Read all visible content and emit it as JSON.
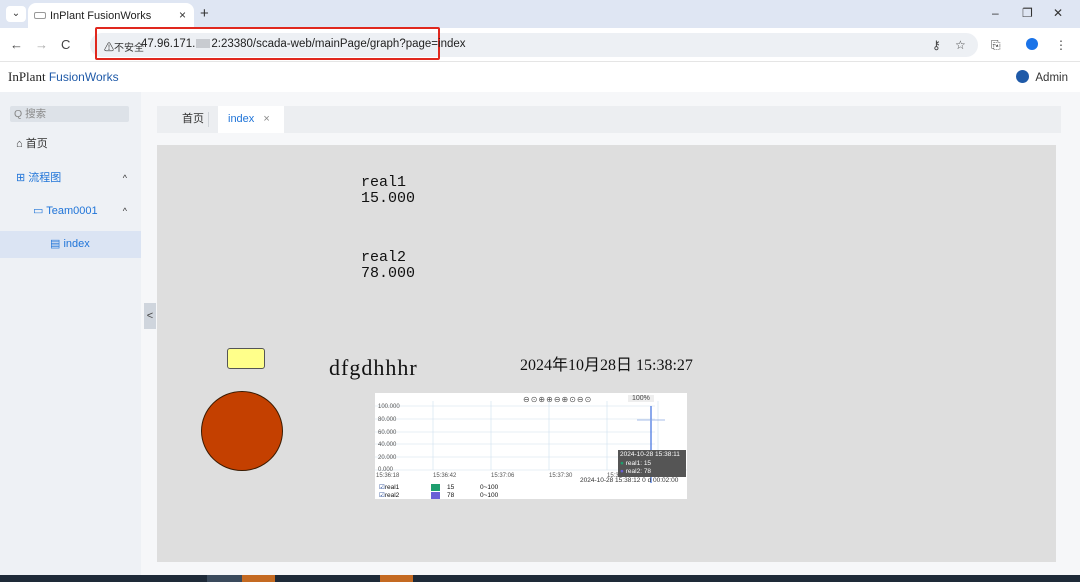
{
  "browser": {
    "tab_title": "InPlant FusionWorks",
    "tab_close": "×",
    "new_tab": "+",
    "menu": "⌄",
    "win_min": "–",
    "win_max": "❐",
    "win_close": "✕",
    "back": "←",
    "forward": "→",
    "reload": "C",
    "security_label": "不安全",
    "url_prefix": "47.96.171.",
    "url_suffix": "2:23380/scada-web/mainPage/graph?page=index",
    "key_icon": "key-icon",
    "star": "☆",
    "extensions": "⎘",
    "kebab": "⋮"
  },
  "app": {
    "logo_main": "InPlant",
    "logo_sub": "FusionWorks",
    "user": "Admin"
  },
  "sidebar": {
    "search_placeholder": "Q 搜索",
    "items": [
      {
        "label": "首页",
        "icon": "home-icon"
      },
      {
        "label": "流程图",
        "icon": "flow-icon",
        "chevron": "^"
      },
      {
        "label": "Team0001",
        "icon": "folder-icon",
        "chevron": "^"
      },
      {
        "label": "index",
        "icon": "file-icon"
      }
    ],
    "collapse": "<"
  },
  "tabs": [
    {
      "label": "首页"
    },
    {
      "label": "index",
      "close": "×"
    }
  ],
  "canvas": {
    "real1_name": "real1",
    "real1_value": "15.000",
    "real2_name": "real2",
    "real2_value": "78.000",
    "text_label": "dfgdhhhr",
    "datetime": "2024年10月28日 15:38:27"
  },
  "trend": {
    "zoom": "100%",
    "y_ticks": [
      "100.000",
      "80.000",
      "60.000",
      "40.000",
      "20.000",
      "0.000"
    ],
    "x_ticks": [
      "15:36:18",
      "15:36:42",
      "15:37:06",
      "15:37:30",
      "15:3",
      "15:38:18"
    ],
    "tooltip": [
      "2024-10-28 15:38:11",
      "real1: 15",
      "real2: 78"
    ],
    "info": "2024-10-28 15:38:12  0 d 00:02:00",
    "legend": [
      {
        "name": "real1",
        "value": "15",
        "range": "0~100",
        "color": "#1e9e6e"
      },
      {
        "name": "real2",
        "value": "78",
        "range": "0~100",
        "color": "#6a5fd6"
      }
    ]
  }
}
